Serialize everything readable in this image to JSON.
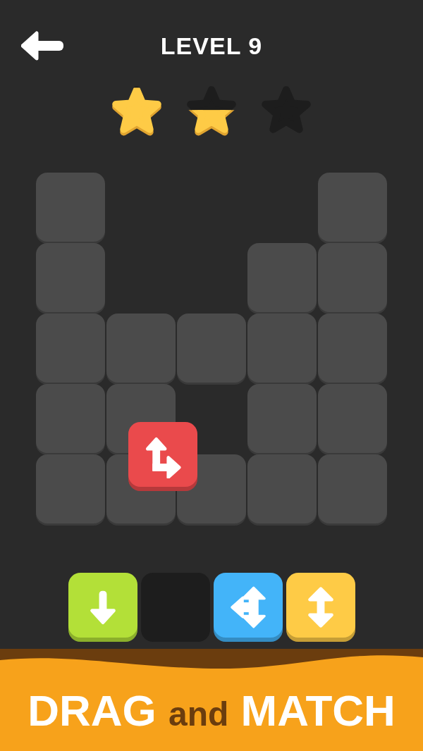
{
  "header": {
    "title": "LEVEL 9"
  },
  "rating": {
    "stars": [
      {
        "filled": true,
        "half": false
      },
      {
        "filled": false,
        "half": true
      },
      {
        "filled": false,
        "half": false
      }
    ]
  },
  "board": {
    "rows": [
      [
        {
          "present": true
        },
        {
          "present": false
        },
        {
          "present": false
        },
        {
          "present": false
        },
        {
          "present": true
        }
      ],
      [
        {
          "present": true
        },
        {
          "present": false
        },
        {
          "present": false
        },
        {
          "present": true
        },
        {
          "present": true
        }
      ],
      [
        {
          "present": true
        },
        {
          "present": true
        },
        {
          "present": true
        },
        {
          "present": true
        },
        {
          "present": true
        }
      ],
      [
        {
          "present": true
        },
        {
          "present": true
        },
        {
          "present": false
        },
        {
          "present": true
        },
        {
          "present": true
        }
      ],
      [
        {
          "present": true
        },
        {
          "present": true
        },
        {
          "present": true
        },
        {
          "present": true
        },
        {
          "present": true
        }
      ]
    ],
    "held_tile": {
      "kind": "up-right",
      "color": "#ea4a4c"
    }
  },
  "tray": [
    {
      "kind": "down",
      "color": "#b3e038"
    },
    {
      "kind": "empty"
    },
    {
      "kind": "left-up-down",
      "color": "#43b4f9"
    },
    {
      "kind": "up-down",
      "color": "#fecb46"
    }
  ],
  "banner": {
    "parts": [
      {
        "text": "DRAG",
        "color": "#ffffff"
      },
      {
        "text": "and",
        "color": "#6b3d0e"
      },
      {
        "text": "MATCH",
        "color": "#ffffff"
      }
    ]
  }
}
